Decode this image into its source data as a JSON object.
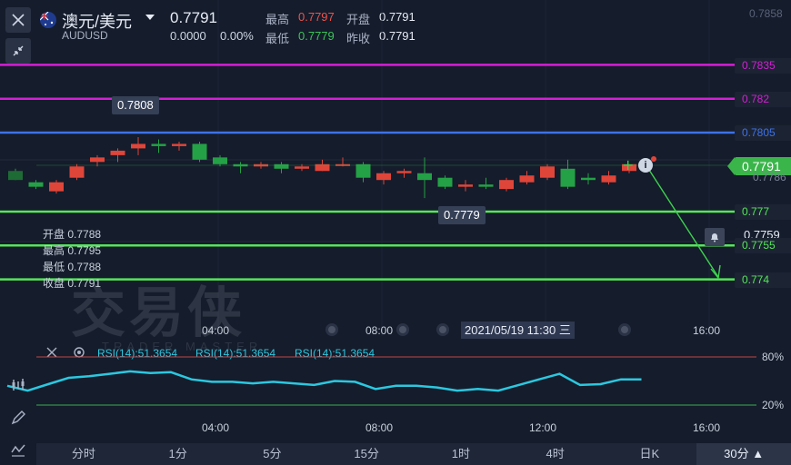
{
  "header": {
    "pair_name": "澳元/美元",
    "symbol": "AUDUSD",
    "last_price": "0.7791",
    "change": "0.0000",
    "change_pct": "0.00%",
    "high_label": "最高",
    "high_value": "0.7797",
    "low_label": "最低",
    "low_value": "0.7779",
    "open_label": "开盘",
    "open_value": "0.7791",
    "prev_close_label": "昨收",
    "prev_close_value": "0.7791"
  },
  "price_axis": {
    "top_tick": "0.7858",
    "tags": [
      {
        "label": "0.7835",
        "color": "#d51fd5"
      },
      {
        "label": "0.782",
        "color": "#d51fd5"
      },
      {
        "label": "0.7805",
        "color": "#3d72e8"
      },
      {
        "label": "0.7791",
        "color": "#3ab54a"
      },
      {
        "label": "0.7786",
        "color": "#7a8296"
      },
      {
        "label": "0.777",
        "color": "#55e65a"
      },
      {
        "label": "0.7759",
        "color": "#e6ebf5"
      },
      {
        "label": "0.7755",
        "color": "#55e65a"
      },
      {
        "label": "0.774",
        "color": "#55e65a"
      }
    ]
  },
  "annotations": {
    "high_callout": "0.7808",
    "low_callout": "0.7779"
  },
  "ohlc_legend": {
    "open": "开盘 0.7788",
    "high": "最高 0.7795",
    "low": "最低 0.7788",
    "close": "收盘 0.7791"
  },
  "watermark": {
    "cn": "交易侠",
    "en": "TRADER MASTER"
  },
  "crosshair_date": "2021/05/19 11:30 三",
  "main_time_axis": [
    "04:00",
    "08:00",
    "16:00"
  ],
  "rsi": {
    "labels": [
      "RSI(14):51.3654",
      "RSI(14):51.3654",
      "RSI(14):51.3654"
    ],
    "level_high": "80%",
    "level_low": "20%",
    "time_axis": [
      "04:00",
      "08:00",
      "12:00",
      "16:00"
    ]
  },
  "tabs": [
    "分时",
    "1分",
    "5分",
    "15分",
    "1时",
    "4时",
    "日K",
    "30分"
  ],
  "active_tab": "30分",
  "colors": {
    "up": "#e0453a",
    "down": "#24a146",
    "rsi_line": "#2bc8e0",
    "bg": "#151c2b"
  },
  "chart_data": {
    "type": "candlestick",
    "candles": [
      {
        "o": 0.7788,
        "h": 0.7789,
        "l": 0.7784,
        "c": 0.7784
      },
      {
        "o": 0.7783,
        "h": 0.7784,
        "l": 0.778,
        "c": 0.7781
      },
      {
        "o": 0.7779,
        "h": 0.7784,
        "l": 0.7778,
        "c": 0.7783
      },
      {
        "o": 0.7785,
        "h": 0.7791,
        "l": 0.7784,
        "c": 0.779
      },
      {
        "o": 0.7792,
        "h": 0.7795,
        "l": 0.779,
        "c": 0.7794
      },
      {
        "o": 0.7795,
        "h": 0.7798,
        "l": 0.7792,
        "c": 0.7797
      },
      {
        "o": 0.7798,
        "h": 0.7803,
        "l": 0.7795,
        "c": 0.78
      },
      {
        "o": 0.78,
        "h": 0.7802,
        "l": 0.7796,
        "c": 0.7799
      },
      {
        "o": 0.7799,
        "h": 0.7801,
        "l": 0.7797,
        "c": 0.78
      },
      {
        "o": 0.78,
        "h": 0.7801,
        "l": 0.7792,
        "c": 0.7793
      },
      {
        "o": 0.7794,
        "h": 0.7795,
        "l": 0.779,
        "c": 0.7791
      },
      {
        "o": 0.7791,
        "h": 0.7792,
        "l": 0.7787,
        "c": 0.779
      },
      {
        "o": 0.779,
        "h": 0.7792,
        "l": 0.7789,
        "c": 0.7791
      },
      {
        "o": 0.7791,
        "h": 0.7792,
        "l": 0.7787,
        "c": 0.7789
      },
      {
        "o": 0.7789,
        "h": 0.7791,
        "l": 0.7788,
        "c": 0.779
      },
      {
        "o": 0.7788,
        "h": 0.7793,
        "l": 0.7788,
        "c": 0.7791
      },
      {
        "o": 0.7791,
        "h": 0.7794,
        "l": 0.779,
        "c": 0.7791
      },
      {
        "o": 0.7791,
        "h": 0.7792,
        "l": 0.7783,
        "c": 0.7785
      },
      {
        "o": 0.7784,
        "h": 0.7788,
        "l": 0.7782,
        "c": 0.7787
      },
      {
        "o": 0.7787,
        "h": 0.7789,
        "l": 0.7785,
        "c": 0.7788
      },
      {
        "o": 0.7787,
        "h": 0.7794,
        "l": 0.7776,
        "c": 0.7784
      },
      {
        "o": 0.7785,
        "h": 0.7786,
        "l": 0.778,
        "c": 0.7781
      },
      {
        "o": 0.7781,
        "h": 0.7784,
        "l": 0.7779,
        "c": 0.7782
      },
      {
        "o": 0.7782,
        "h": 0.7785,
        "l": 0.778,
        "c": 0.7781
      },
      {
        "o": 0.778,
        "h": 0.7785,
        "l": 0.7779,
        "c": 0.7784
      },
      {
        "o": 0.7783,
        "h": 0.7788,
        "l": 0.7782,
        "c": 0.7786
      },
      {
        "o": 0.7785,
        "h": 0.7791,
        "l": 0.7784,
        "c": 0.779
      },
      {
        "o": 0.7789,
        "h": 0.7793,
        "l": 0.778,
        "c": 0.7781
      },
      {
        "o": 0.7785,
        "h": 0.7787,
        "l": 0.7782,
        "c": 0.7784
      },
      {
        "o": 0.7783,
        "h": 0.7788,
        "l": 0.7782,
        "c": 0.7786
      },
      {
        "o": 0.7788,
        "h": 0.7791,
        "l": 0.7787,
        "c": 0.7791
      }
    ],
    "horizontal_levels": [
      0.7835,
      0.782,
      0.7805,
      0.777,
      0.7755,
      0.774
    ],
    "rsi_values": [
      44,
      38,
      46,
      54,
      56,
      59,
      62,
      60,
      61,
      52,
      49,
      49,
      47,
      49,
      47,
      45,
      50,
      49,
      40,
      44,
      44,
      42,
      38,
      40,
      38,
      45,
      52,
      59,
      45,
      46,
      52,
      52
    ]
  }
}
